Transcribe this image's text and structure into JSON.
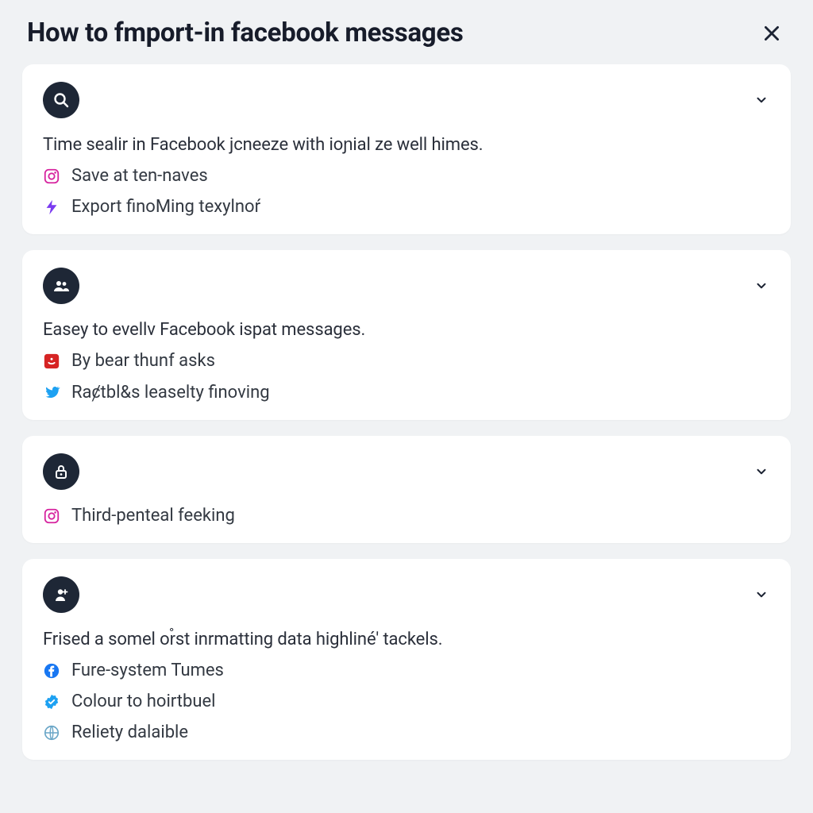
{
  "header": {
    "title": "How to fmport-in facebook messages"
  },
  "cards": [
    {
      "icon": "search",
      "description": "Time sealir in Facebook jcneeze with ioɲial ze well himes.",
      "items": [
        {
          "icon": "instagram",
          "text": "Save at ten-naves"
        },
        {
          "icon": "bolt",
          "text": "Export finoMing texylnoŕ"
        }
      ]
    },
    {
      "icon": "people",
      "description": "Easey to evellv Facebook ispat messages.",
      "items": [
        {
          "icon": "redbox",
          "text": "By bear thunf asks"
        },
        {
          "icon": "twitter",
          "text": "Raȼtbl&s leaselty finoving"
        }
      ]
    },
    {
      "icon": "lock",
      "description": "",
      "items": [
        {
          "icon": "instagram",
          "text": "Third-penteal feeking"
        }
      ]
    },
    {
      "icon": "person-plus",
      "description": "Frised a somel or̊st inrmatting data highliné' tackels.",
      "items": [
        {
          "icon": "facebook",
          "text": "Fure-system Tumes"
        },
        {
          "icon": "badge",
          "text": "Colour to hoirtbuel"
        },
        {
          "icon": "globe",
          "text": "Reliety dalaible"
        }
      ]
    }
  ]
}
